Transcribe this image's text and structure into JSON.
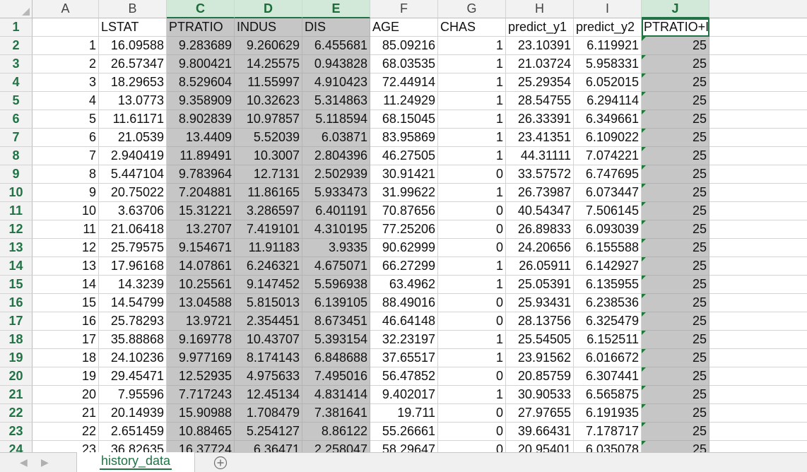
{
  "colors": {
    "accent": "#217346",
    "selection": "#c6c6c6",
    "header_highlight": "#d2e9d9"
  },
  "columns": [
    "A",
    "B",
    "C",
    "D",
    "E",
    "F",
    "G",
    "H",
    "I",
    "J"
  ],
  "selected_columns": [
    "C",
    "D",
    "E",
    "J"
  ],
  "headers": [
    "",
    "LSTAT",
    "PTRATIO",
    "INDUS",
    "DIS",
    "AGE",
    "CHAS",
    "predict_y1",
    "predict_y2",
    "PTRATIO+INDUS+DIS"
  ],
  "rows": [
    [
      "1",
      "16.09588",
      "9.283689",
      "9.260629",
      "6.455681",
      "85.09216",
      "1",
      "23.10391",
      "6.119921",
      "25"
    ],
    [
      "2",
      "26.57347",
      "9.800421",
      "14.25575",
      "0.943828",
      "68.03535",
      "1",
      "21.03724",
      "5.958331",
      "25"
    ],
    [
      "3",
      "18.29653",
      "8.529604",
      "11.55997",
      "4.910423",
      "72.44914",
      "1",
      "25.29354",
      "6.052015",
      "25"
    ],
    [
      "4",
      "13.0773",
      "9.358909",
      "10.32623",
      "5.314863",
      "11.24929",
      "1",
      "28.54755",
      "6.294114",
      "25"
    ],
    [
      "5",
      "11.61171",
      "8.902839",
      "10.97857",
      "5.118594",
      "68.15045",
      "1",
      "26.33391",
      "6.349661",
      "25"
    ],
    [
      "6",
      "21.0539",
      "13.4409",
      "5.52039",
      "6.03871",
      "83.95869",
      "1",
      "23.41351",
      "6.109022",
      "25"
    ],
    [
      "7",
      "2.940419",
      "11.89491",
      "10.3007",
      "2.804396",
      "46.27505",
      "1",
      "44.31111",
      "7.074221",
      "25"
    ],
    [
      "8",
      "5.447104",
      "9.783964",
      "12.7131",
      "2.502939",
      "30.91421",
      "0",
      "33.57572",
      "6.747695",
      "25"
    ],
    [
      "9",
      "20.75022",
      "7.204881",
      "11.86165",
      "5.933473",
      "31.99622",
      "1",
      "26.73987",
      "6.073447",
      "25"
    ],
    [
      "10",
      "3.63706",
      "15.31221",
      "3.286597",
      "6.401191",
      "70.87656",
      "0",
      "40.54347",
      "7.506145",
      "25"
    ],
    [
      "11",
      "21.06418",
      "13.2707",
      "7.419101",
      "4.310195",
      "77.25206",
      "0",
      "26.89833",
      "6.093039",
      "25"
    ],
    [
      "12",
      "25.79575",
      "9.154671",
      "11.91183",
      "3.9335",
      "90.62999",
      "0",
      "24.20656",
      "6.155588",
      "25"
    ],
    [
      "13",
      "17.96168",
      "14.07861",
      "6.246321",
      "4.675071",
      "66.27299",
      "1",
      "26.05911",
      "6.142927",
      "25"
    ],
    [
      "14",
      "14.3239",
      "10.25561",
      "9.147452",
      "5.596938",
      "63.4962",
      "1",
      "25.05391",
      "6.135955",
      "25"
    ],
    [
      "15",
      "14.54799",
      "13.04588",
      "5.815013",
      "6.139105",
      "88.49016",
      "0",
      "25.93431",
      "6.238536",
      "25"
    ],
    [
      "16",
      "25.78293",
      "13.9721",
      "2.354451",
      "8.673451",
      "46.64148",
      "0",
      "28.13756",
      "6.325479",
      "25"
    ],
    [
      "17",
      "35.88868",
      "9.169778",
      "10.43707",
      "5.393154",
      "32.23197",
      "1",
      "25.54505",
      "6.152511",
      "25"
    ],
    [
      "18",
      "24.10236",
      "9.977169",
      "8.174143",
      "6.848688",
      "37.65517",
      "1",
      "23.91562",
      "6.016672",
      "25"
    ],
    [
      "19",
      "29.45471",
      "12.52935",
      "4.975633",
      "7.495016",
      "56.47852",
      "0",
      "20.85759",
      "6.307441",
      "25"
    ],
    [
      "20",
      "7.95596",
      "7.717243",
      "12.45134",
      "4.831414",
      "9.402017",
      "1",
      "30.90533",
      "6.565875",
      "25"
    ],
    [
      "21",
      "20.14939",
      "15.90988",
      "1.708479",
      "7.381641",
      "19.711",
      "0",
      "27.97655",
      "6.191935",
      "25"
    ],
    [
      "22",
      "2.651459",
      "10.88465",
      "5.254127",
      "8.86122",
      "55.26661",
      "0",
      "39.66431",
      "7.178717",
      "25"
    ],
    [
      "23",
      "36.82635",
      "16.37724",
      "6.36471",
      "2.258047",
      "58.29647",
      "0",
      "20.95401",
      "6.035078",
      "25"
    ]
  ],
  "tabs": {
    "sheet_name": "history_data",
    "prev_icon": "chevron-left-icon",
    "next_icon": "chevron-right-icon",
    "add_icon": "plus-circle-icon"
  }
}
